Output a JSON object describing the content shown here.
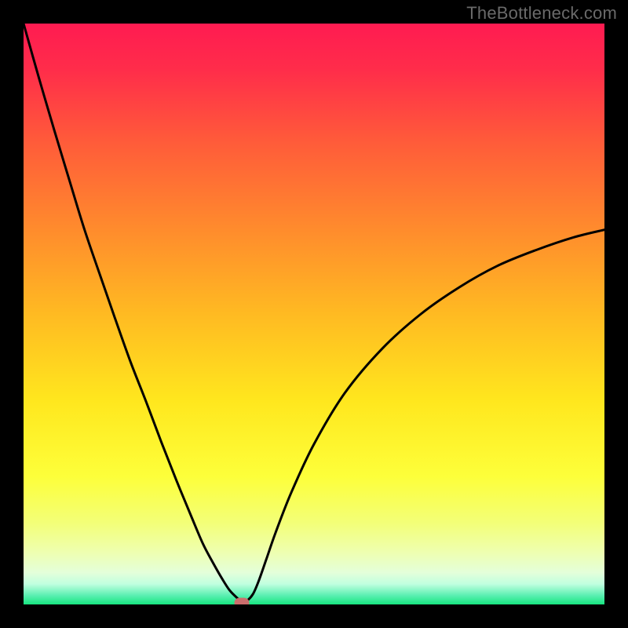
{
  "watermark": {
    "text": "TheBottleneck.com"
  },
  "chart_data": {
    "type": "line",
    "title": "",
    "xlabel": "",
    "ylabel": "",
    "xlim": [
      0,
      100
    ],
    "ylim": [
      0,
      100
    ],
    "gradient_stops": [
      {
        "pos": 0.0,
        "color": "#ff1b51"
      },
      {
        "pos": 0.08,
        "color": "#ff2d4a"
      },
      {
        "pos": 0.2,
        "color": "#ff5a3a"
      },
      {
        "pos": 0.35,
        "color": "#ff8a2d"
      },
      {
        "pos": 0.5,
        "color": "#ffba22"
      },
      {
        "pos": 0.65,
        "color": "#ffe71e"
      },
      {
        "pos": 0.78,
        "color": "#fdff3a"
      },
      {
        "pos": 0.86,
        "color": "#f3ff78"
      },
      {
        "pos": 0.91,
        "color": "#eeffb0"
      },
      {
        "pos": 0.945,
        "color": "#e4ffda"
      },
      {
        "pos": 0.965,
        "color": "#c0ffdf"
      },
      {
        "pos": 0.985,
        "color": "#58efb0"
      },
      {
        "pos": 1.0,
        "color": "#17e580"
      }
    ],
    "series": [
      {
        "name": "bottleneck-curve",
        "x": [
          0.0,
          2.6,
          5.3,
          7.9,
          10.5,
          13.2,
          15.8,
          18.4,
          21.1,
          23.7,
          26.3,
          28.9,
          30.9,
          32.6,
          34.2,
          35.5,
          36.8,
          37.6,
          38.4,
          39.5,
          40.5,
          41.8,
          43.4,
          46.1,
          50.0,
          55.3,
          61.8,
          68.4,
          75.0,
          81.6,
          88.2,
          94.7,
          100.0
        ],
        "y": [
          100.0,
          90.8,
          81.6,
          73.0,
          64.5,
          56.6,
          49.1,
          41.8,
          34.9,
          28.0,
          21.4,
          15.1,
          10.4,
          7.2,
          4.4,
          2.4,
          1.1,
          0.5,
          0.6,
          1.8,
          4.1,
          7.8,
          12.4,
          19.3,
          27.6,
          36.4,
          44.1,
          50.0,
          54.6,
          58.3,
          61.0,
          63.2,
          64.5
        ]
      }
    ],
    "marker": {
      "x": 37.5,
      "y": 0.3,
      "color": "#cb6e6d"
    }
  }
}
